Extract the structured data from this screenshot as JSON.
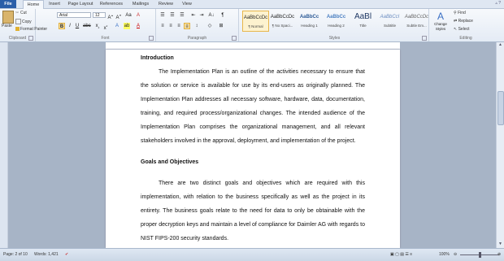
{
  "tabs": {
    "file": "File",
    "home": "Home",
    "insert": "Insert",
    "page_layout": "Page Layout",
    "references": "References",
    "mailings": "Mailings",
    "review": "Review",
    "view": "View"
  },
  "clipboard": {
    "paste": "Paste",
    "cut": "Cut",
    "copy": "Copy",
    "format_painter": "Format Painter",
    "label": "Clipboard"
  },
  "font": {
    "name": "Arial",
    "size": "12",
    "label": "Font"
  },
  "paragraph": {
    "label": "Paragraph"
  },
  "styles": {
    "label": "Styles",
    "items": [
      {
        "preview": "AaBbCcDc",
        "name": "¶ Normal"
      },
      {
        "preview": "AaBbCcDc",
        "name": "¶ No Spaci..."
      },
      {
        "preview": "AaBbCc",
        "name": "Heading 1"
      },
      {
        "preview": "AaBbCc",
        "name": "Heading 2"
      },
      {
        "preview": "AaBl",
        "name": "Title"
      },
      {
        "preview": "AaBbCcI",
        "name": "Subtitle"
      },
      {
        "preview": "AaBbCcDc",
        "name": "Subtle Em..."
      }
    ],
    "change_styles": "Change Styles"
  },
  "editing": {
    "find": "Find",
    "replace": "Replace",
    "select": "Select",
    "label": "Editing"
  },
  "document": {
    "heading1": "Introduction",
    "para1": "The Implementation Plan is an outline of the activities necessary to ensure that the solution or service is available for use by its end-users as originally planned. The Implementation Plan addresses all necessary software, hardware, data, documentation, training, and required process/organizational changes. The intended audience of the Implementation Plan comprises the organizational management, and all relevant stakeholders involved in the approval, deployment, and implementation of the project.",
    "heading2": "Goals and Objectives",
    "para2": "There are two distinct goals and objectives which are required with this implementation, with relation to the business specifically as well as the project in its entirety. The business goals relate to the need for data to only be obtainable with the proper decryption keys and maintain a level of compliance for Daimler AG with regards to NIST FIPS-200 security standards."
  },
  "status": {
    "page": "Page: 2 of 10",
    "words": "Words: 1,421",
    "zoom": "100%"
  }
}
